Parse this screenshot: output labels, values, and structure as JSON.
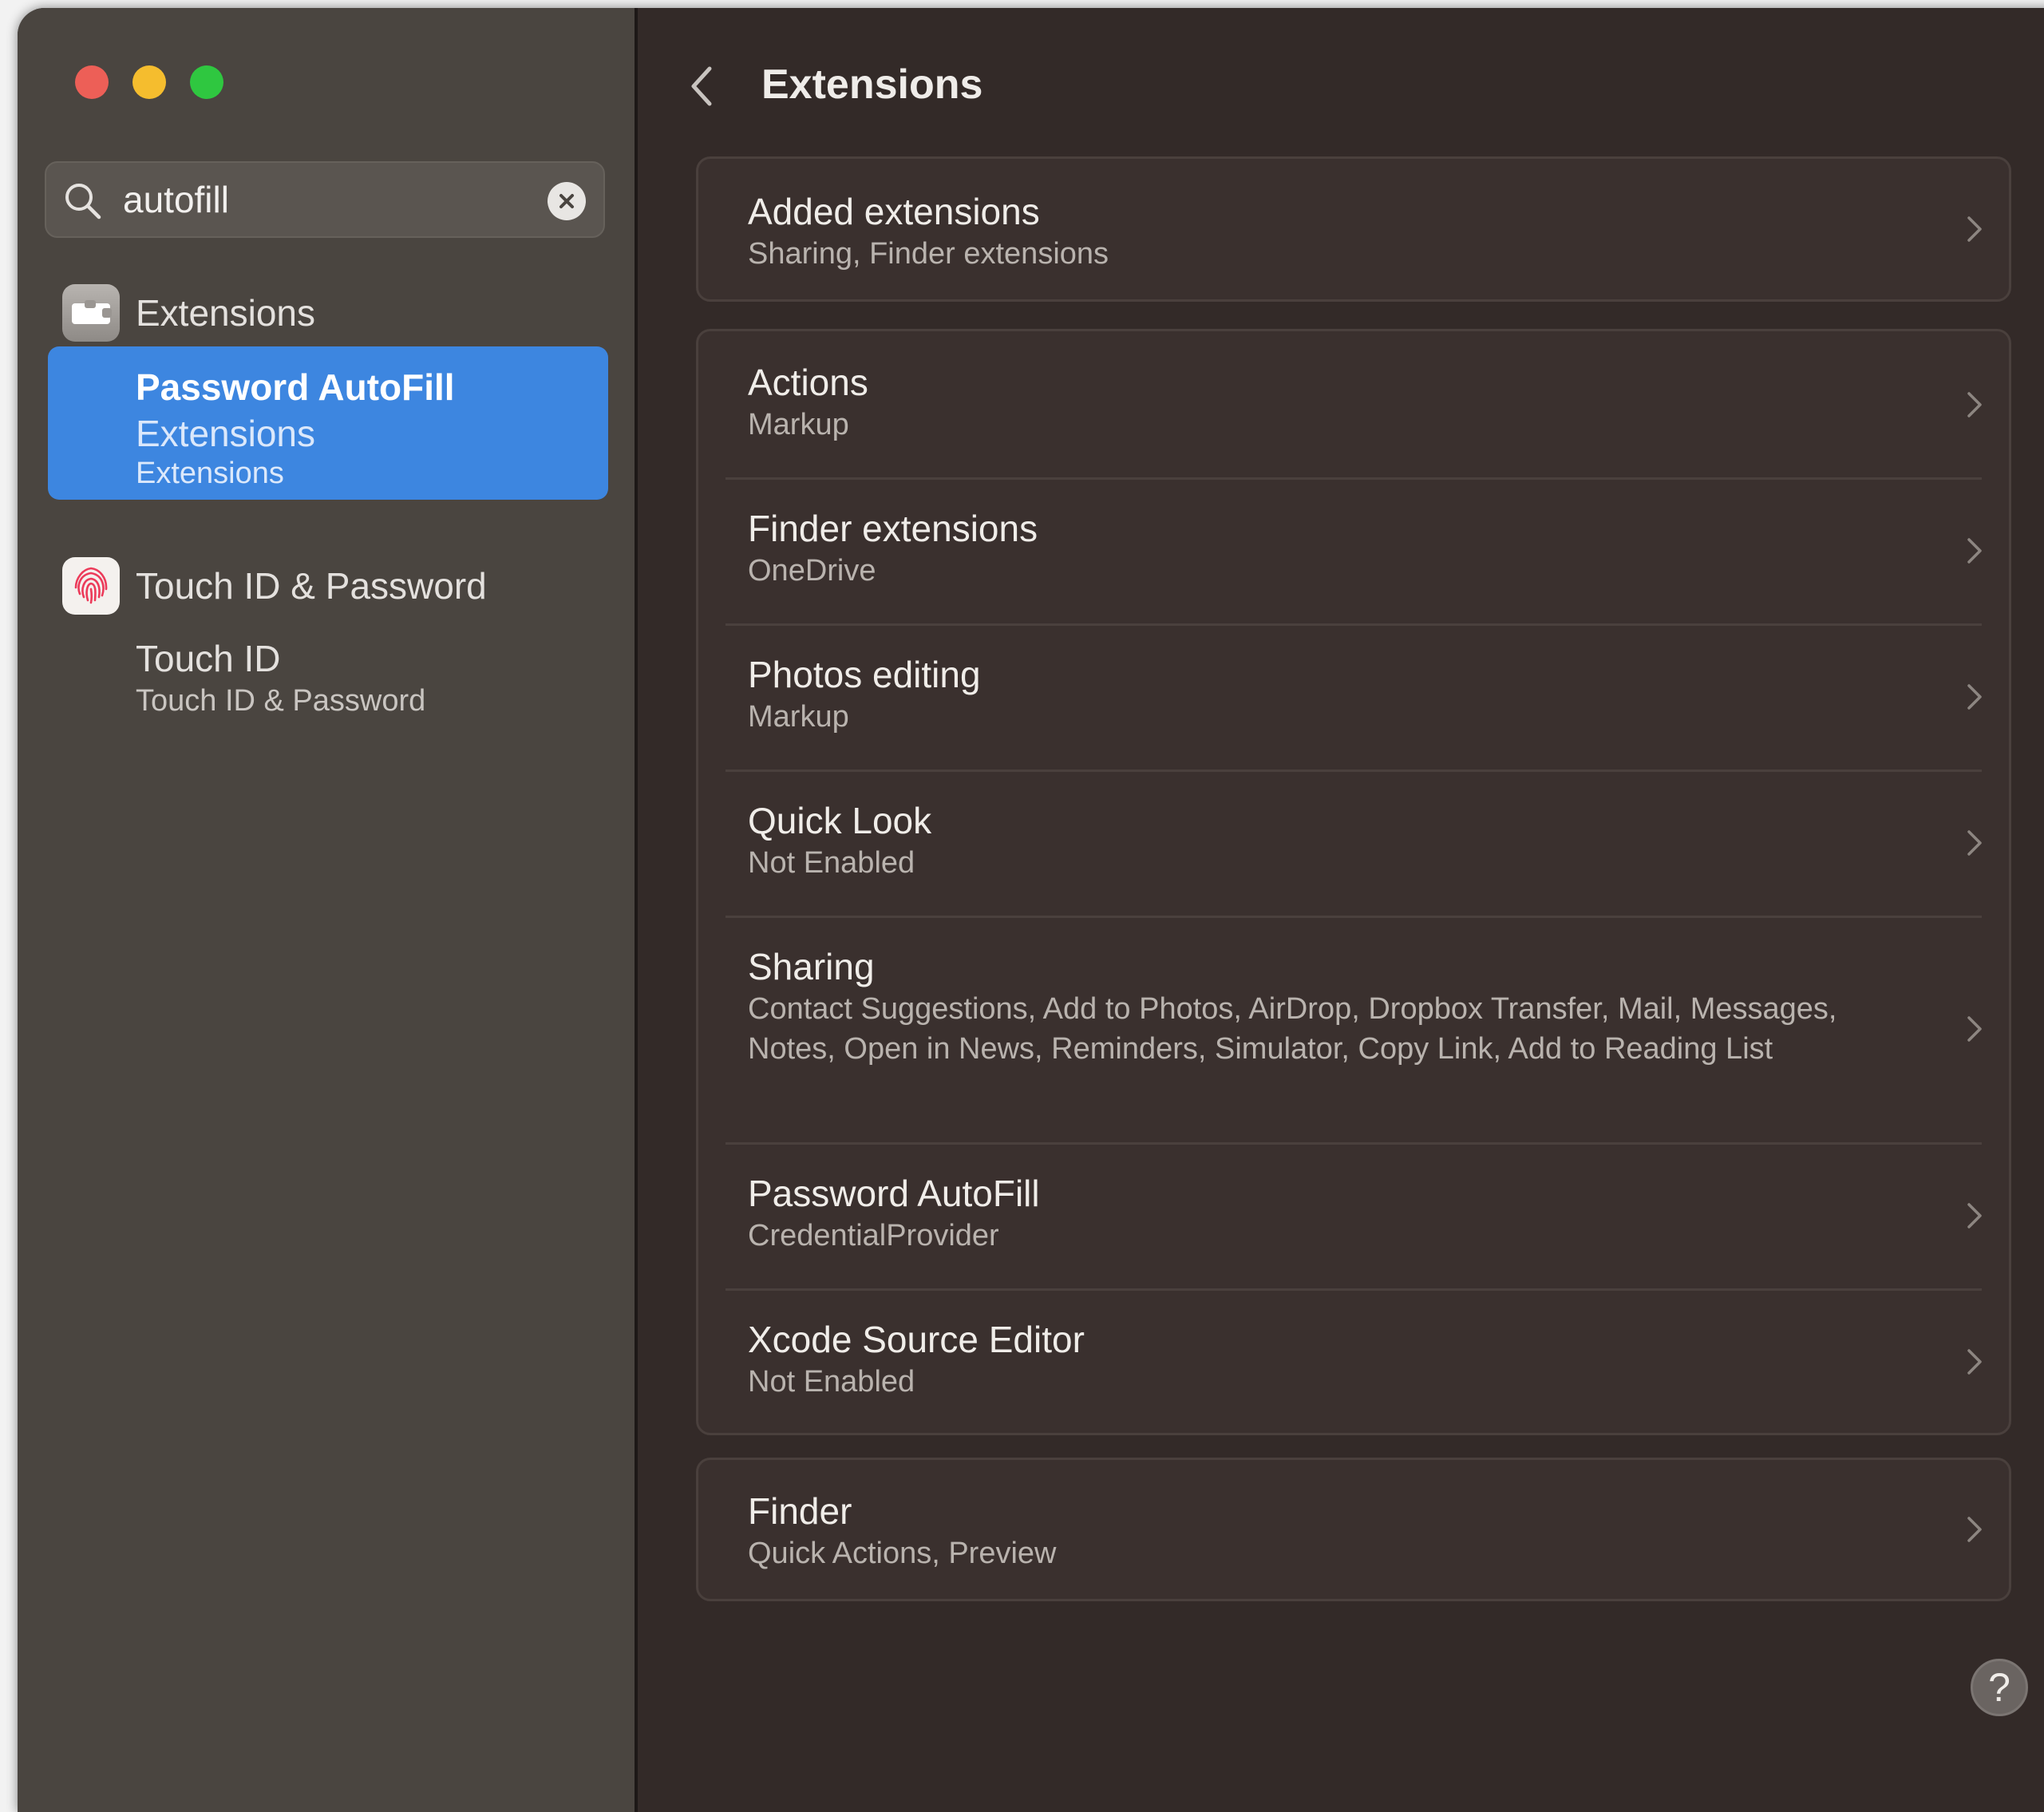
{
  "search": {
    "value": "autofill"
  },
  "sidebar": {
    "sections": [
      {
        "header": "Extensions",
        "item": {
          "title_highlight": "Password AutoFill",
          "title_rest": "Extensions",
          "subtitle": "Extensions"
        }
      },
      {
        "header": "Touch ID & Password",
        "item": {
          "title": "Touch ID",
          "subtitle": "Touch ID & Password"
        }
      }
    ]
  },
  "main": {
    "title": "Extensions",
    "groups": [
      {
        "rows": [
          {
            "title": "Added extensions",
            "subtitle": "Sharing, Finder extensions"
          }
        ]
      },
      {
        "rows": [
          {
            "title": "Actions",
            "subtitle": "Markup"
          },
          {
            "title": "Finder extensions",
            "subtitle": "OneDrive"
          },
          {
            "title": "Photos editing",
            "subtitle": "Markup"
          },
          {
            "title": "Quick Look",
            "subtitle": "Not Enabled"
          },
          {
            "title": "Sharing",
            "subtitle": "Contact Suggestions, Add to Photos, AirDrop, Dropbox Transfer, Mail, Messages, Notes, Open in News, Reminders, Simulator, Copy Link, Add to Reading List"
          },
          {
            "title": "Password AutoFill",
            "subtitle": "CredentialProvider"
          },
          {
            "title": "Xcode Source Editor",
            "subtitle": "Not Enabled"
          }
        ]
      },
      {
        "rows": [
          {
            "title": "Finder",
            "subtitle": "Quick Actions, Preview"
          }
        ]
      }
    ],
    "help": "?"
  },
  "colors": {
    "accent": "#3d86e0",
    "sidebar_bg": "#4a4540",
    "main_bg": "#332a28",
    "close": "#ed5f57",
    "minimize": "#f5bd2e",
    "zoom": "#2fc740"
  },
  "icons": [
    "search-icon",
    "clear-icon",
    "extensions-icon",
    "fingerprint-icon",
    "back-chevron-icon",
    "chevron-right-icon",
    "help-icon"
  ]
}
